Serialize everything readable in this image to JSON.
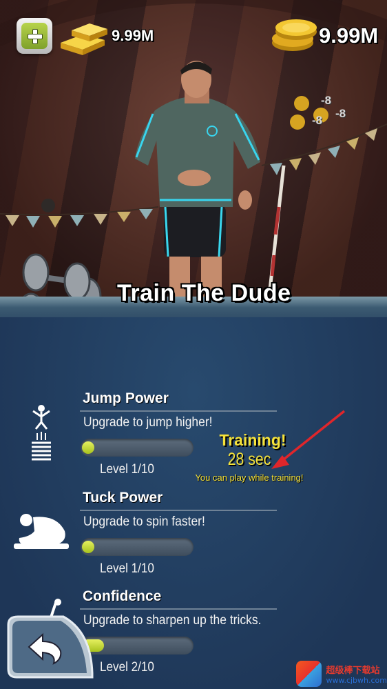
{
  "hud": {
    "gold_bars": "9.99M",
    "coins": "9.99M",
    "floating_rewards": [
      "-8",
      "-8",
      "-8"
    ]
  },
  "title": "Train The Dude",
  "skills": [
    {
      "name": "Jump Power",
      "description": "Upgrade to jump higher!",
      "level_text": "Level 1/10",
      "progress": 0.1,
      "icon": "jumper-spring-icon"
    },
    {
      "name": "Tuck Power",
      "description": "Upgrade to spin faster!",
      "level_text": "Level 1/10",
      "progress": 0.1,
      "icon": "tuck-pose-icon"
    },
    {
      "name": "Confidence",
      "description": "Upgrade to sharpen up the tricks.",
      "level_text": "Level 2/10",
      "progress": 0.2,
      "icon": "flag-icon"
    }
  ],
  "training": {
    "status": "Training!",
    "timer": "28 sec",
    "note": "You can play while training!"
  },
  "watermark": {
    "title": "超级棒下载站",
    "url": "www.cjbwh.com"
  },
  "colors": {
    "panel": "#21395a",
    "accent_yellow": "#f5e23a",
    "bar_fill": "#c3d63a",
    "arrow": "#e0262b"
  }
}
